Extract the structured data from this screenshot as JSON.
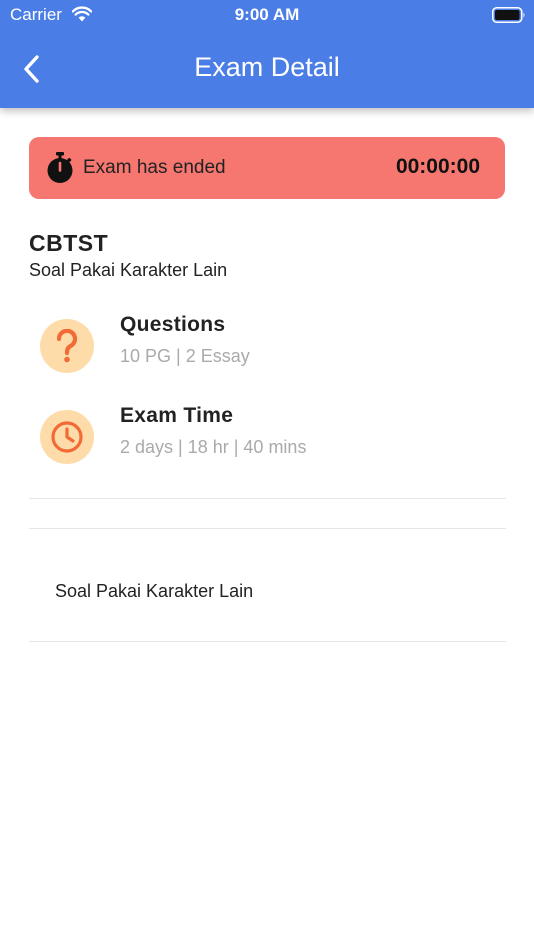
{
  "status_bar": {
    "carrier": "Carrier",
    "time": "9:00 AM"
  },
  "header": {
    "title": "Exam Detail",
    "back_icon": "chevron-left-icon"
  },
  "banner": {
    "text": "Exam has ended",
    "countdown": "00:00:00",
    "icon": "stopwatch-icon",
    "color": "#f6776f"
  },
  "exam": {
    "code": "CBTST",
    "name": "Soal Pakai Karakter Lain"
  },
  "details": {
    "questions": {
      "icon": "question-mark-icon",
      "title": "Questions",
      "value": "10 PG | 2 Essay"
    },
    "exam_time": {
      "icon": "clock-icon",
      "title": "Exam Time",
      "value": "2 days | 18 hr | 40 mins"
    }
  },
  "description": "Soal Pakai Karakter Lain",
  "colors": {
    "header": "#4a7de6",
    "icon_bg": "#fddcaa",
    "icon_fg": "#f26a35"
  }
}
